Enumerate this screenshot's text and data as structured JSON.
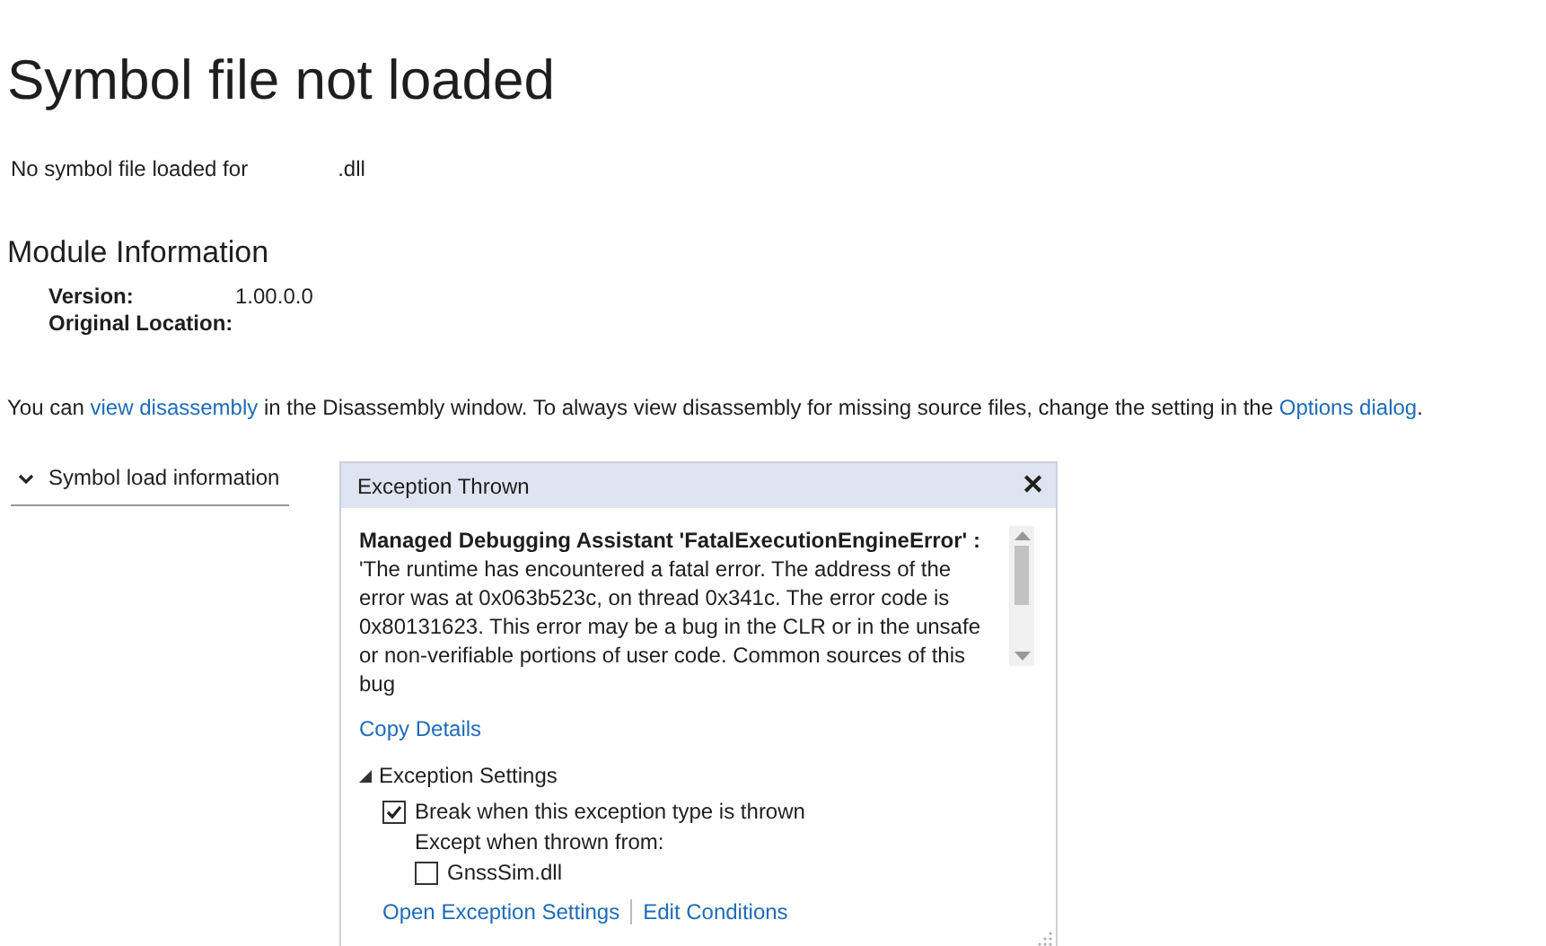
{
  "title": "Symbol file not loaded",
  "subtitle": {
    "prefix": "No symbol file loaded for",
    "suffix": ".dll"
  },
  "module_info": {
    "heading": "Module Information",
    "fields": [
      {
        "label": "Version:",
        "value": "1.00.0.0"
      },
      {
        "label": "Original Location:"
      }
    ]
  },
  "note": [
    {
      "kind": "text",
      "text": "You can "
    },
    {
      "kind": "link",
      "text": "view disassembly"
    },
    {
      "kind": "text",
      "text": " in the Disassembly window. To always view disassembly for missing source files, change the setting in the "
    },
    {
      "kind": "link",
      "text": "Options dialog"
    },
    {
      "kind": "text",
      "text": "."
    }
  ],
  "symbol_load": {
    "label": "Symbol load information",
    "expanded": true
  },
  "popup": {
    "title": "Exception Thrown",
    "close": "✕",
    "message": "**Managed Debugging Assistant 'FatalExecutionEngineError' :** 'The runtime has encountered a fatal error. The address of the error was at 0x063b523c, on thread 0x341c. The error code is 0x80131623. This error may be a bug in the CLR or in the unsafe or non-verifiable portions of user code. Common sources of this bug",
    "copy_details": "Copy Details",
    "settings": {
      "label": "Exception Settings",
      "expanded": true,
      "break_option": {
        "label": "Break when this exception type is thrown",
        "checked": true
      },
      "except_label": "Except when thrown from:",
      "modules": [
        {
          "label": "GnssSim.dll",
          "checked": false
        }
      ]
    },
    "links": [
      "Open Exception Settings",
      "Edit Conditions"
    ]
  }
}
